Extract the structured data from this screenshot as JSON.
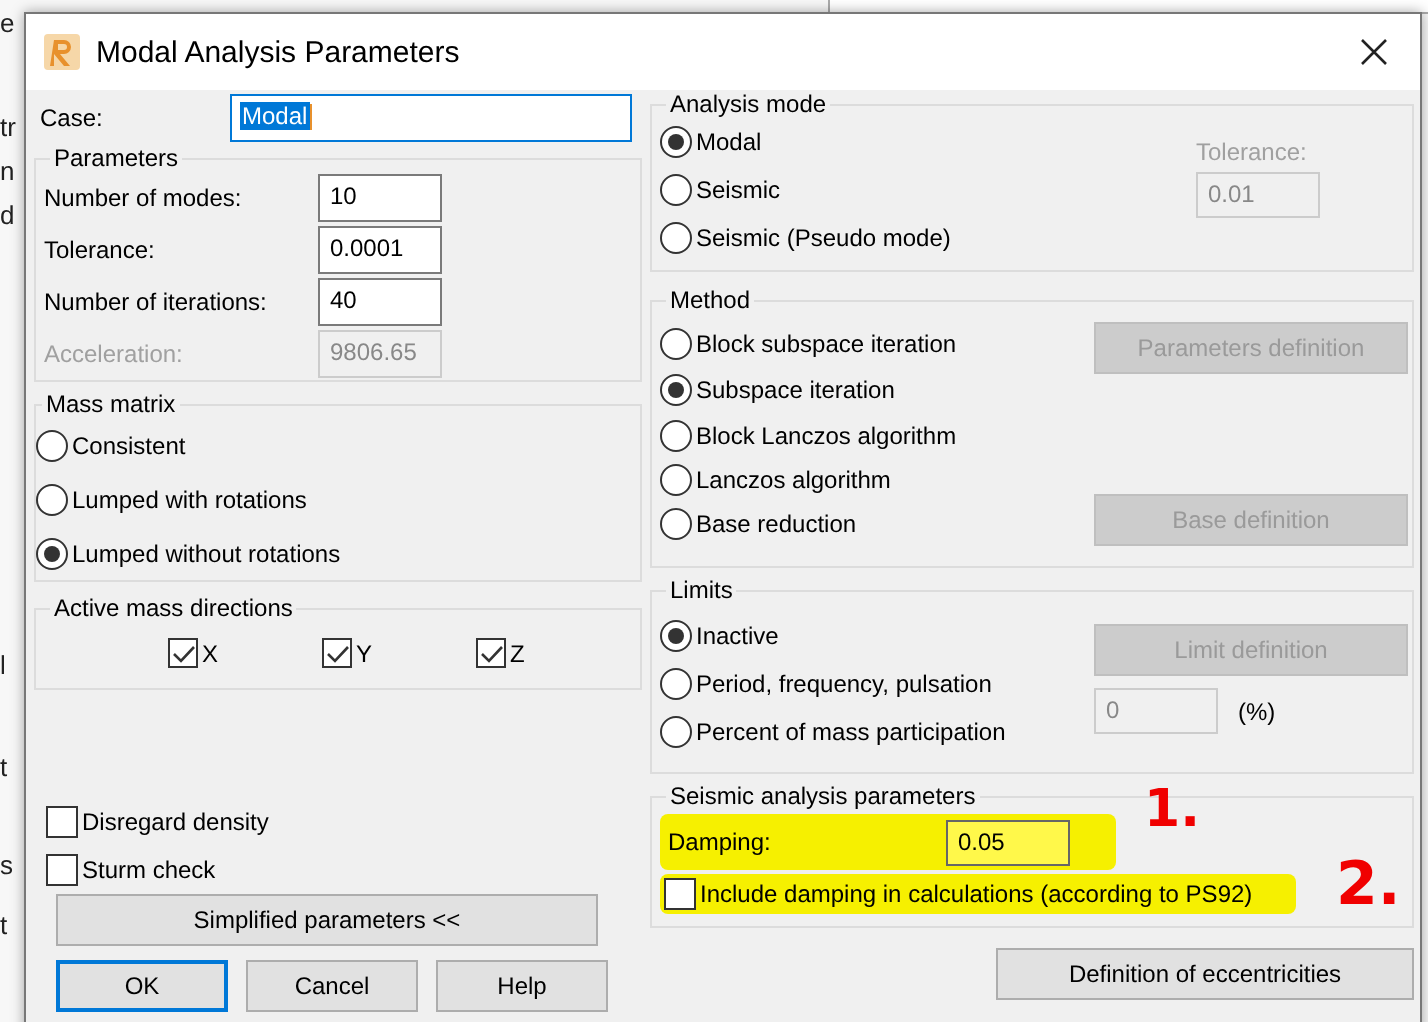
{
  "background": {
    "fragments": [
      "e",
      "tr",
      "n",
      "d",
      "l",
      "t",
      "s",
      "t"
    ]
  },
  "window": {
    "title": "Modal Analysis Parameters"
  },
  "case": {
    "label": "Case:",
    "value": "Modal"
  },
  "parameters": {
    "title": "Parameters",
    "fields": [
      {
        "label": "Number of modes:",
        "value": "10",
        "disabled": false
      },
      {
        "label": "Tolerance:",
        "value": "0.0001",
        "disabled": false
      },
      {
        "label": "Number of iterations:",
        "value": "40",
        "disabled": false
      },
      {
        "label": "Acceleration:",
        "value": "9806.65",
        "disabled": true
      }
    ]
  },
  "mass_matrix": {
    "title": "Mass matrix",
    "options": [
      {
        "label": "Consistent",
        "selected": false
      },
      {
        "label": "Lumped with rotations",
        "selected": false
      },
      {
        "label": "Lumped without rotations",
        "selected": true
      }
    ]
  },
  "active_mass_directions": {
    "title": "Active mass directions",
    "options": [
      {
        "label": "X",
        "checked": true
      },
      {
        "label": "Y",
        "checked": true
      },
      {
        "label": "Z",
        "checked": true
      }
    ]
  },
  "options": [
    {
      "label": "Disregard density",
      "checked": false
    },
    {
      "label": "Sturm check",
      "checked": false
    }
  ],
  "simplified_button": "Simplified parameters <<",
  "buttons": [
    "OK",
    "Cancel",
    "Help"
  ],
  "analysis_mode": {
    "title": "Analysis mode",
    "options": [
      {
        "label": "Modal",
        "selected": true
      },
      {
        "label": "Seismic",
        "selected": false
      },
      {
        "label": "Seismic (Pseudo mode)",
        "selected": false
      }
    ],
    "tolerance": {
      "label": "Tolerance:",
      "value": "0.01",
      "disabled": true
    }
  },
  "method": {
    "title": "Method",
    "options": [
      {
        "label": "Block subspace iteration",
        "selected": false
      },
      {
        "label": "Subspace iteration",
        "selected": true
      },
      {
        "label": "Block Lanczos algorithm",
        "selected": false
      },
      {
        "label": "Lanczos algorithm",
        "selected": false
      },
      {
        "label": "Base reduction",
        "selected": false
      }
    ],
    "parameters_button": {
      "label": "Parameters definition",
      "disabled": true
    },
    "base_button": {
      "label": "Base definition",
      "disabled": true
    }
  },
  "limits": {
    "title": "Limits",
    "options": [
      {
        "label": "Inactive",
        "selected": true
      },
      {
        "label": "Period, frequency, pulsation",
        "selected": false
      },
      {
        "label": "Percent of mass participation",
        "selected": false
      }
    ],
    "limit_button": {
      "label": "Limit definition",
      "disabled": true
    },
    "percent": {
      "value": "0",
      "unit": "(%)",
      "disabled": true
    }
  },
  "seismic": {
    "title": "Seismic analysis parameters",
    "damping": {
      "label": "Damping:",
      "value": "0.05",
      "highlighted": true
    },
    "include": {
      "label": "Include damping in calculations (according to PS92)",
      "checked": false,
      "highlighted": true
    }
  },
  "eccentricities_button": "Definition of eccentricities",
  "annotations": [
    {
      "text": "1."
    },
    {
      "text": "2."
    }
  ]
}
